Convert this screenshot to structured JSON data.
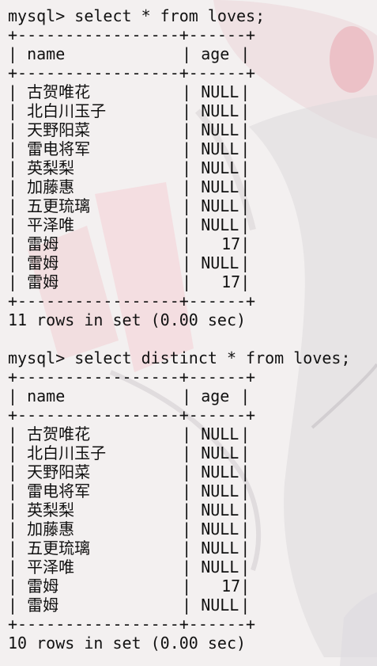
{
  "query_1": {
    "prompt": "mysql>",
    "command": "select * from loves;",
    "separator": "+-----------------+------+",
    "headers": [
      "name",
      "age"
    ],
    "rows": [
      {
        "name": "古贺唯花",
        "age": "NULL"
      },
      {
        "name": "北白川玉子",
        "age": "NULL"
      },
      {
        "name": "天野阳菜",
        "age": "NULL"
      },
      {
        "name": "雷电将军",
        "age": "NULL"
      },
      {
        "name": "英梨梨",
        "age": "NULL"
      },
      {
        "name": "加藤惠",
        "age": "NULL"
      },
      {
        "name": "五更琉璃",
        "age": "NULL"
      },
      {
        "name": "平泽唯",
        "age": "NULL"
      },
      {
        "name": "雷姆",
        "age": "17"
      },
      {
        "name": "雷姆",
        "age": "NULL"
      },
      {
        "name": "雷姆",
        "age": "17"
      }
    ],
    "summary": "11 rows in set (0.00 sec)"
  },
  "query_2": {
    "prompt": "mysql>",
    "command": "select distinct * from loves;",
    "separator": "+-----------------+------+",
    "headers": [
      "name",
      "age"
    ],
    "rows": [
      {
        "name": "古贺唯花",
        "age": "NULL"
      },
      {
        "name": "北白川玉子",
        "age": "NULL"
      },
      {
        "name": "天野阳菜",
        "age": "NULL"
      },
      {
        "name": "雷电将军",
        "age": "NULL"
      },
      {
        "name": "英梨梨",
        "age": "NULL"
      },
      {
        "name": "加藤惠",
        "age": "NULL"
      },
      {
        "name": "五更琉璃",
        "age": "NULL"
      },
      {
        "name": "平泽唯",
        "age": "NULL"
      },
      {
        "name": "雷姆",
        "age": "17"
      },
      {
        "name": "雷姆",
        "age": "NULL"
      }
    ],
    "summary": "10 rows in set (0.00 sec)"
  }
}
